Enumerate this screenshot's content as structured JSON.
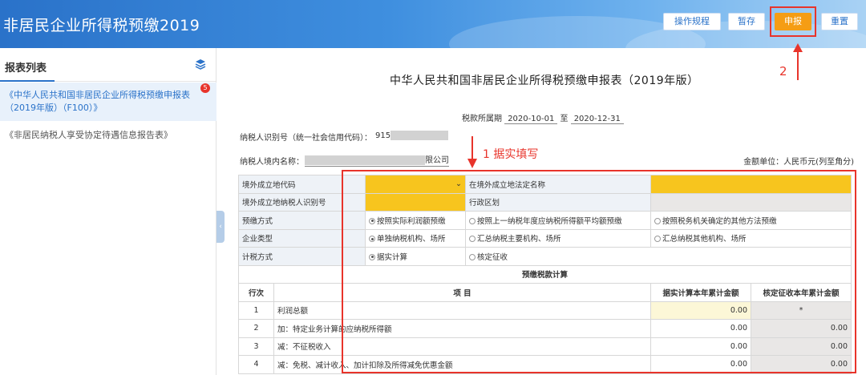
{
  "app": {
    "title": "非居民企业所得税预缴2019"
  },
  "toolbar": {
    "rules_label": "操作规程",
    "save_draft_label": "暂存",
    "declare_label": "申报",
    "reset_label": "重置"
  },
  "annotations": {
    "step2": "2",
    "step1": "1 据实填写"
  },
  "sidebar": {
    "title": "报表列表",
    "items": [
      {
        "label": "《中华人民共和国非居民企业所得税预缴申报表（2019年版）（F100）》",
        "badge": "5"
      },
      {
        "label": "《非居民纳税人享受协定待遇信息报告表》"
      }
    ]
  },
  "form": {
    "title": "中华人民共和国非居民企业所得税预缴申报表（2019年版）",
    "period_label": "税款所属期",
    "period_start": "2020-10-01",
    "period_to": "至",
    "period_end": "2020-12-31",
    "taxpayer_id_label": "纳税人识别号（统一社会信用代码）：",
    "taxpayer_id_visible": "915",
    "taxpayer_name_label": "纳税人境内名称：",
    "taxpayer_name_visible": "限公司",
    "unit_label": "金额单位：人民币元(列至角分)"
  },
  "table": {
    "row_foreign_code": "境外成立地代码",
    "row_foreign_name": "在境外成立地法定名称",
    "row_foreign_tin": "境外成立地纳税人识别号",
    "row_admin_region": "行政区划",
    "row_prepay_method": "预缴方式",
    "prepay_options": [
      "按照实际利润额预缴",
      "按照上一纳税年度应纳税所得额平均额预缴",
      "按照税务机关确定的其他方法预缴"
    ],
    "row_enterprise_type": "企业类型",
    "enterprise_options": [
      "单独纳税机构、场所",
      "汇总纳税主要机构、场所",
      "汇总纳税其他机构、场所"
    ],
    "row_tax_method": "计税方式",
    "tax_method_options": [
      "据实计算",
      "核定征收"
    ],
    "section_title": "预缴税款计算",
    "col_row_no": "行次",
    "col_item": "项  目",
    "col_actual": "据实计算本年累计金额",
    "col_assessed": "核定征收本年累计金额",
    "rows": [
      {
        "no": "1",
        "item": "利润总额",
        "actual": "0.00",
        "assessed": "*"
      },
      {
        "no": "2",
        "item": "加：特定业务计算的应纳税所得额",
        "actual": "0.00",
        "assessed": "0.00"
      },
      {
        "no": "3",
        "item": "减：不征税收入",
        "actual": "0.00",
        "assessed": "0.00"
      },
      {
        "no": "4",
        "item": "减：免税、减计收入、加计扣除及所得减免优惠金额",
        "actual": "0.00",
        "assessed": "0.00"
      }
    ]
  },
  "colors": {
    "header_blue": "#2a72c9",
    "accent_orange": "#f59d14",
    "annotation_red": "#e8342b",
    "input_yellow": "#f7c51e"
  },
  "icons": [
    "layers-icon",
    "chevron-down-icon",
    "arrow-down-icon",
    "collapse-left-icon"
  ]
}
